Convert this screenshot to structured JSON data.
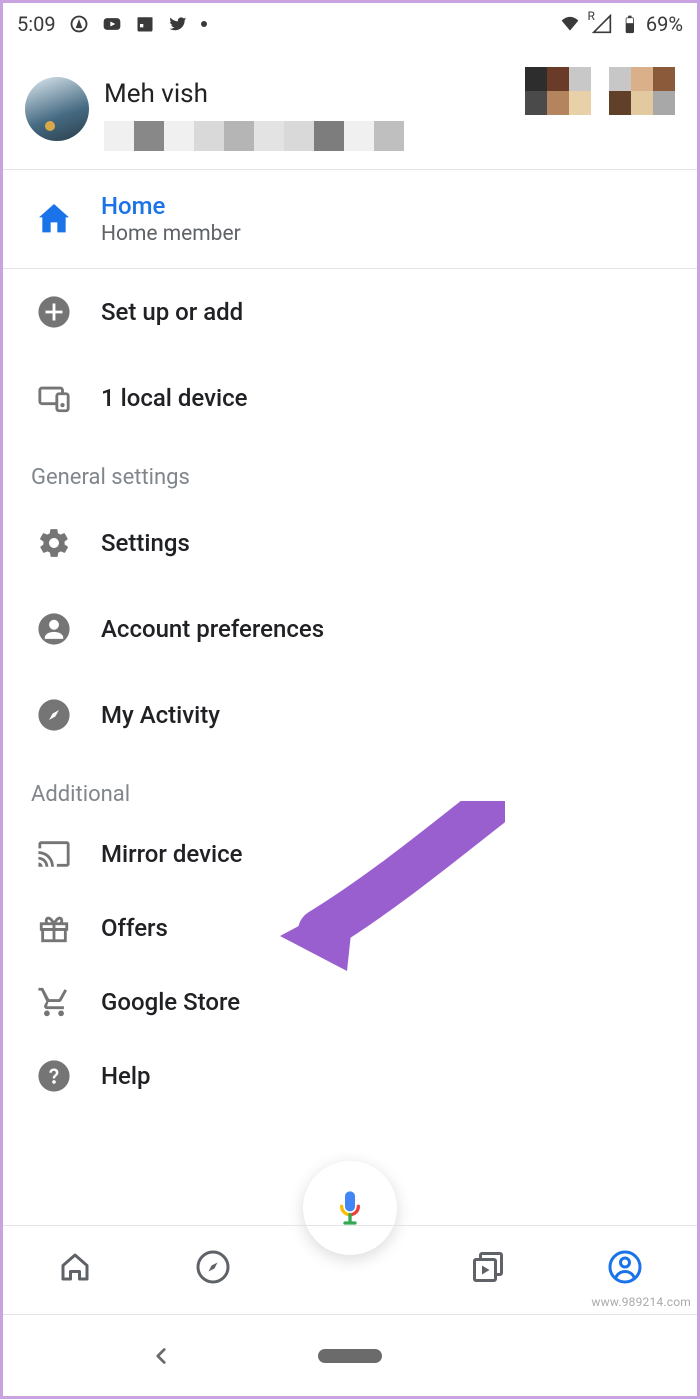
{
  "status": {
    "time": "5:09",
    "battery": "69%",
    "r_label": "R"
  },
  "profile": {
    "name": "Meh vish"
  },
  "home_section": {
    "title": "Home",
    "subtitle": "Home member"
  },
  "items": {
    "setup": "Set up or add",
    "local_device": "1 local device"
  },
  "sections": {
    "general": "General settings",
    "additional": "Additional"
  },
  "general_items": {
    "settings": "Settings",
    "account_prefs": "Account preferences",
    "activity": "My Activity"
  },
  "additional_items": {
    "mirror": "Mirror device",
    "offers": "Offers",
    "store": "Google Store",
    "help": "Help"
  },
  "watermark": "www.989214.com"
}
